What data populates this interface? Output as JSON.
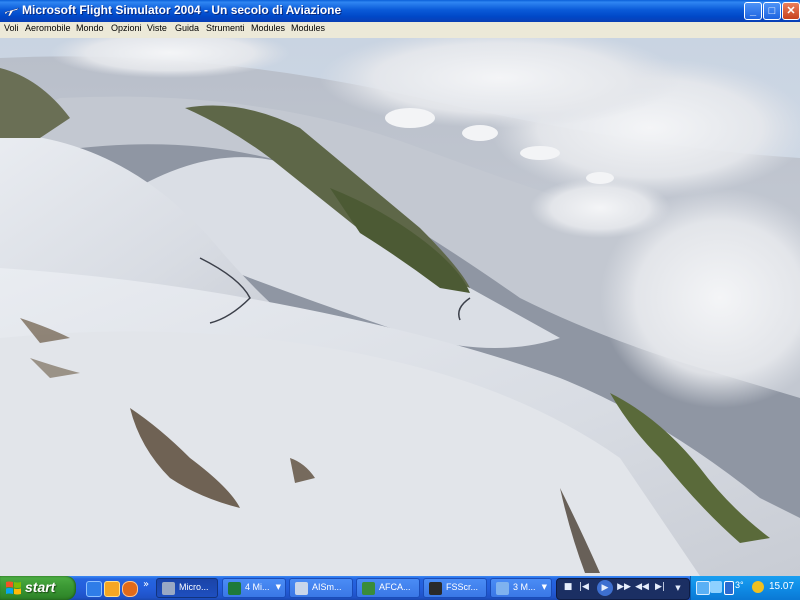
{
  "window": {
    "title": "Microsoft Flight Simulator 2004 - Un secolo di Aviazione",
    "controls": {
      "minimize": "_",
      "maximize": "□",
      "close": "✕"
    }
  },
  "menu": {
    "items": [
      "Voli",
      "Aeromobile",
      "Mondo",
      "Opzioni",
      "Viste",
      "Guida",
      "Strumenti",
      "Modules",
      "Modules"
    ]
  },
  "taskbar": {
    "start_label": "start",
    "quick_launch": [
      "internet-explorer-icon",
      "media-player-icon",
      "firefox-icon"
    ],
    "quick_launch_more": "»",
    "tasks": [
      {
        "label": "Micro...",
        "icon": "flight-simulator-icon",
        "active": true
      },
      {
        "label": "4 Mi...",
        "icon": "excel-icon",
        "active": false
      },
      {
        "label": "AISm...",
        "icon": "program-icon",
        "active": false
      },
      {
        "label": "AFCA...",
        "icon": "program-icon",
        "active": false
      },
      {
        "label": "FSScr...",
        "icon": "program-icon",
        "active": false
      },
      {
        "label": "3 M...",
        "icon": "program-icon",
        "active": false
      }
    ],
    "media_controls": [
      "■",
      "|◀",
      "▶▶",
      "◀◀",
      "▶|",
      "▼"
    ],
    "tray": {
      "temperature": "3°",
      "clock": "15.07"
    }
  },
  "colors": {
    "titlebar": "#0a5ad8",
    "menubar": "#ece9d8",
    "taskbar": "#245edc",
    "start_button": "#3c9a35",
    "tray": "#0f8ce6"
  }
}
